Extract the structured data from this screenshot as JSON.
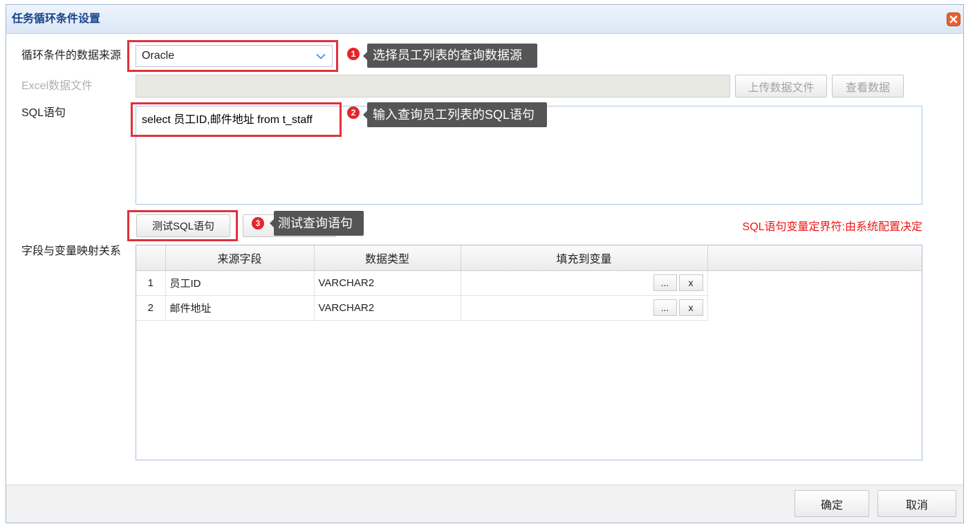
{
  "window": {
    "title": "任务循环条件设置"
  },
  "icons": {
    "close": "close-icon",
    "dropdown": "chevron-down-icon"
  },
  "form": {
    "data_source": {
      "label": "循环条件的数据来源",
      "value": "Oracle"
    },
    "excel_file": {
      "label": "Excel数据文件",
      "upload_label": "上传数据文件",
      "view_label": "查看数据"
    },
    "sql": {
      "label": "SQL语句",
      "value": "select 员工ID,邮件地址 from t_staff"
    },
    "test_button_label": "测试SQL语句",
    "delimiter_note": "SQL语句变量定界符:由系统配置决定",
    "mapping": {
      "label": "字段与变量映射关系",
      "columns": [
        "来源字段",
        "数据类型",
        "填充到变量"
      ],
      "rows": [
        {
          "index": "1",
          "source": "员工ID",
          "type": "VARCHAR2"
        },
        {
          "index": "2",
          "source": "邮件地址",
          "type": "VARCHAR2"
        }
      ],
      "pick_label": "...",
      "clear_label": "x"
    }
  },
  "annotations": [
    {
      "number": "1",
      "text": "选择员工列表的查询数据源"
    },
    {
      "number": "2",
      "text": "输入查询员工列表的SQL语句"
    },
    {
      "number": "3",
      "text": "测试查询语句"
    }
  ],
  "footer": {
    "ok_label": "确定",
    "cancel_label": "取消"
  },
  "colors": {
    "highlight": "#e0303a",
    "badge": "#e3262d",
    "tooltip": "#555555",
    "note": "#f01414",
    "title": "#15428b",
    "close_icon": "#e8622f"
  }
}
